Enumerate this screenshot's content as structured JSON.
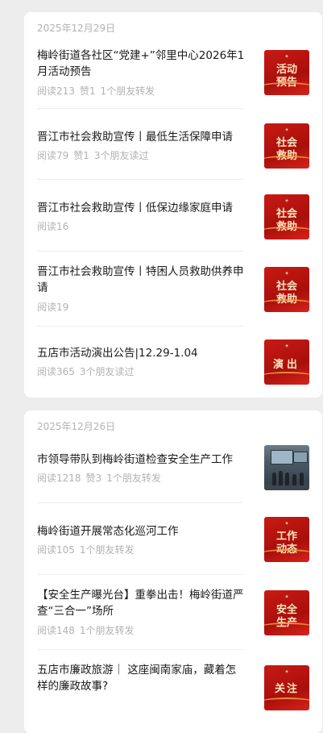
{
  "groups": [
    {
      "date": "2025年12月29日",
      "articles": [
        {
          "title": "梅岭街道各社区“党建+”邻里中心2026年1月活动预告",
          "meta": [
            "阅读213",
            "赞1",
            "1个朋友转发"
          ],
          "thumb": {
            "kind": "text",
            "lines": [
              "活动",
              "预告"
            ]
          }
        },
        {
          "title": "晋江市社会救助宣传丨最低生活保障申请",
          "meta": [
            "阅读79",
            "赞1",
            "3个朋友读过"
          ],
          "thumb": {
            "kind": "text",
            "lines": [
              "社会",
              "救助"
            ]
          }
        },
        {
          "title": "晋江市社会救助宣传丨低保边缘家庭申请",
          "meta": [
            "阅读16"
          ],
          "thumb": {
            "kind": "text",
            "lines": [
              "社会",
              "救助"
            ]
          }
        },
        {
          "title": "晋江市社会救助宣传丨特困人员救助供养申请",
          "meta": [
            "阅读19"
          ],
          "thumb": {
            "kind": "text",
            "lines": [
              "社会",
              "救助"
            ]
          }
        },
        {
          "title": "五店市活动演出公告|12.29-1.04",
          "meta": [
            "阅读365",
            "3个朋友读过"
          ],
          "thumb": {
            "kind": "text",
            "lines": [
              "演出"
            ]
          }
        }
      ]
    },
    {
      "date": "2025年12月26日",
      "articles": [
        {
          "title": "市领导带队到梅岭街道检查安全生产工作",
          "meta": [
            "阅读1218",
            "赞3",
            "1个朋友转发"
          ],
          "thumb": {
            "kind": "photo",
            "lines": []
          }
        },
        {
          "title": "梅岭街道开展常态化巡河工作",
          "meta": [
            "阅读105",
            "1个朋友转发"
          ],
          "thumb": {
            "kind": "text",
            "lines": [
              "工作",
              "动态"
            ]
          }
        },
        {
          "title": "【安全生产曝光台】重拳出击！梅岭街道严查“三合一”场所",
          "meta": [
            "阅读148",
            "1个朋友转发"
          ],
          "thumb": {
            "kind": "text",
            "lines": [
              "安全",
              "生产"
            ]
          }
        },
        {
          "title": "五店市廉政旅游｜ 这座闽南家庙，藏着怎样的廉政故事?",
          "meta": [],
          "thumb": {
            "kind": "text",
            "lines": [
              "关注"
            ]
          }
        }
      ]
    }
  ]
}
